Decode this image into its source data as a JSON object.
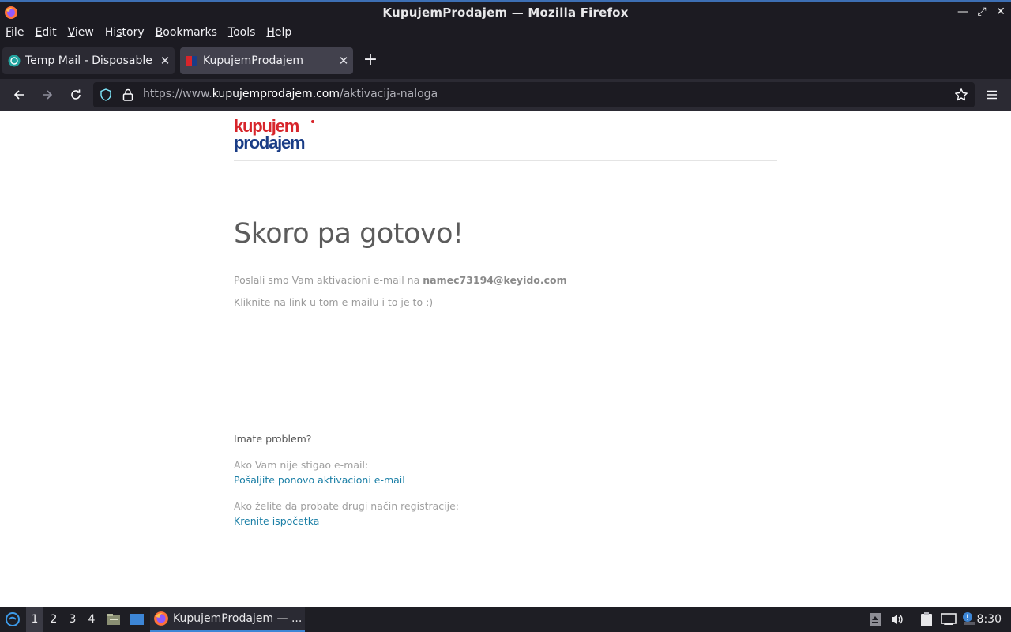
{
  "window": {
    "title": "KupujemProdajem — Mozilla Firefox"
  },
  "menu": [
    "File",
    "Edit",
    "View",
    "History",
    "Bookmarks",
    "Tools",
    "Help"
  ],
  "menu_mnemonics": [
    "F",
    "E",
    "V",
    "s",
    "B",
    "T",
    "H"
  ],
  "tabs": [
    {
      "label": "Temp Mail - Disposable T",
      "favicon": "tempmail-icon",
      "active": false
    },
    {
      "label": "KupujemProdajem",
      "favicon": "kp-icon",
      "active": true
    }
  ],
  "navbar": {
    "url_prefix": "https://www.",
    "url_host": "kupujemprodajem.com",
    "url_path": "/aktivacija-naloga"
  },
  "page": {
    "logo_line1": "kupujem",
    "logo_line2": "prodajem",
    "heading": "Skoro pa gotovo!",
    "sent_text": "Poslali smo Vam aktivacioni e-mail na",
    "email": "namec73194@keyido.com",
    "click_text": "Kliknite na link u tom e-mailu i to je to :)",
    "problem_title": "Imate problem?",
    "hint_resend": "Ako Vam nije stigao e-mail:",
    "link_resend": "Pošaljite ponovo aktivacioni e-mail",
    "hint_restart": "Ako želite da probate drugi način registracije:",
    "link_restart": "Krenite ispočetka"
  },
  "taskbar": {
    "workspaces": [
      "1",
      "2",
      "3",
      "4"
    ],
    "active_workspace": "1",
    "task_label": "KupujemProdajem — ...",
    "clock": "8:30"
  },
  "colors": {
    "chrome_dark": "#1c1b22",
    "link": "#1b7fa6",
    "heading": "#5c5c5c"
  }
}
